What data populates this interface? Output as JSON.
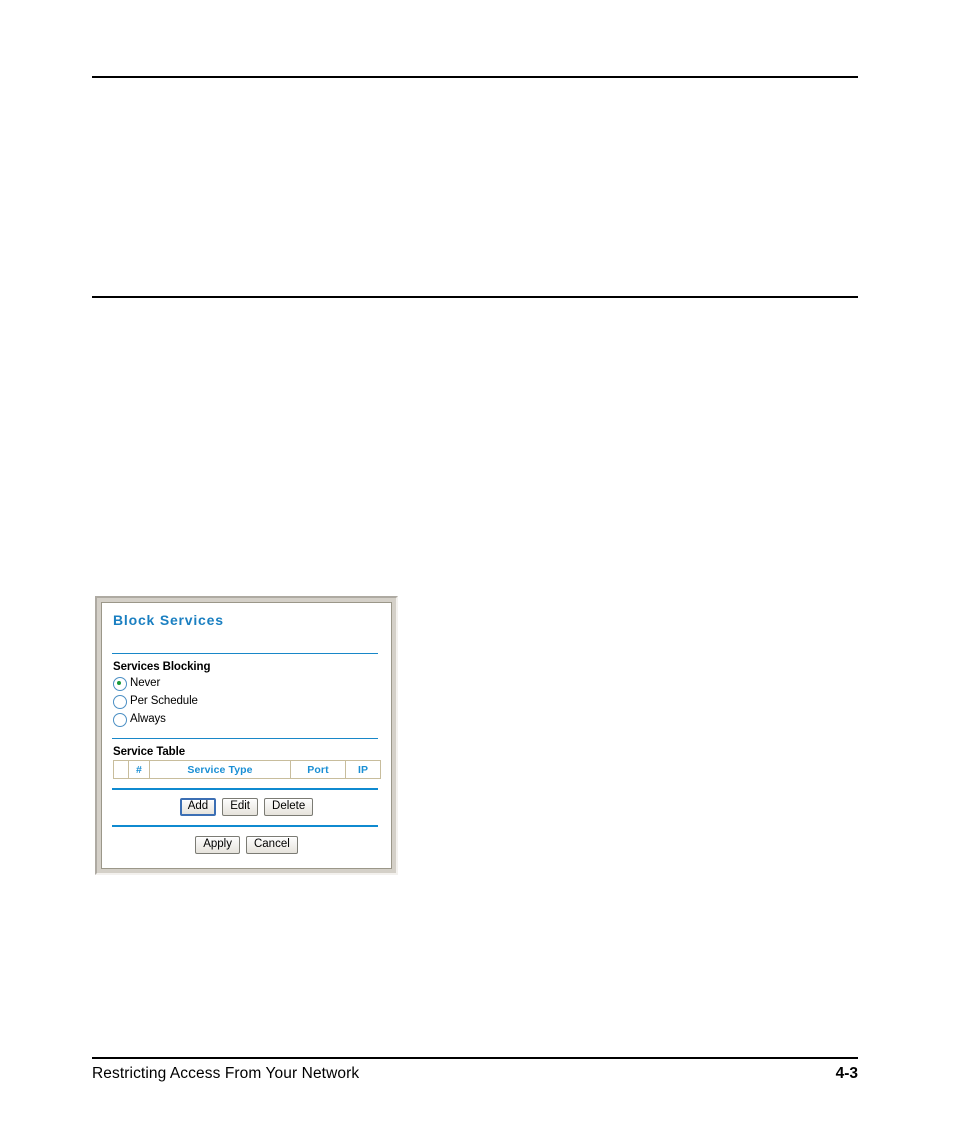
{
  "page": {
    "footer_title": "Restricting Access From Your Network",
    "page_number": "4-3"
  },
  "dialog": {
    "heading": "Block Services",
    "services_blocking": {
      "label": "Services Blocking",
      "selected": "Never",
      "options": [
        {
          "label": "Never",
          "checked": true
        },
        {
          "label": "Per Schedule",
          "checked": false
        },
        {
          "label": "Always",
          "checked": false
        }
      ]
    },
    "service_table": {
      "label": "Service Table",
      "columns": [
        "",
        "#",
        "Service Type",
        "Port",
        "IP"
      ],
      "rows": []
    },
    "crud_buttons": {
      "add": "Add",
      "edit": "Edit",
      "delete": "Delete"
    },
    "action_buttons": {
      "apply": "Apply",
      "cancel": "Cancel"
    }
  },
  "colors": {
    "heading_blue": "#1a7fc1",
    "divider_blue": "#1887c8",
    "table_header_blue": "#1a8fd4",
    "table_border_tan": "#c8bd9c",
    "radio_selected_green": "#1a9a3c",
    "frame_gray": "#d4d0c8"
  }
}
